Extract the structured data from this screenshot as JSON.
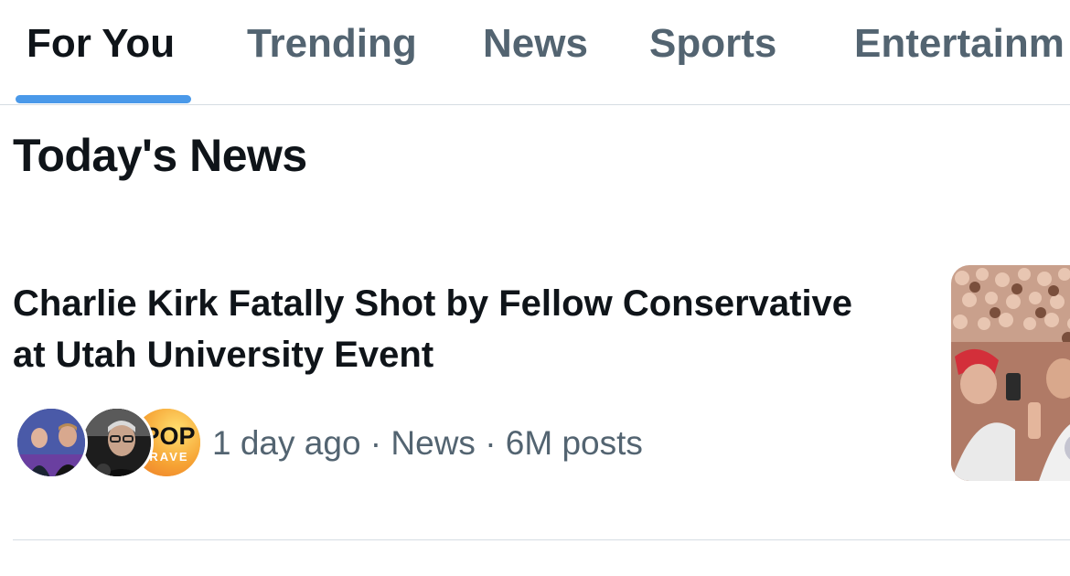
{
  "tabs": [
    {
      "label": "For You",
      "active": true
    },
    {
      "label": "Trending",
      "active": false
    },
    {
      "label": "News",
      "active": false
    },
    {
      "label": "Sports",
      "active": false
    },
    {
      "label": "Entertainm",
      "active": false
    }
  ],
  "accent_color": "#4a99e9",
  "section": {
    "title": "Today's News"
  },
  "story": {
    "headline": "Charlie Kirk Fatally Shot by Fellow Conservative at Utah University Event",
    "meta": "1 day ago · News · 6M posts",
    "avatars": [
      {
        "icon": "person-avatar-icon"
      },
      {
        "icon": "person-avatar-icon"
      },
      {
        "icon": "source-logo-icon",
        "logo_text": "POP",
        "logo_subtext": "RAVE"
      }
    ],
    "thumbnail": {
      "icon": "crowd-photo-thumbnail"
    }
  }
}
